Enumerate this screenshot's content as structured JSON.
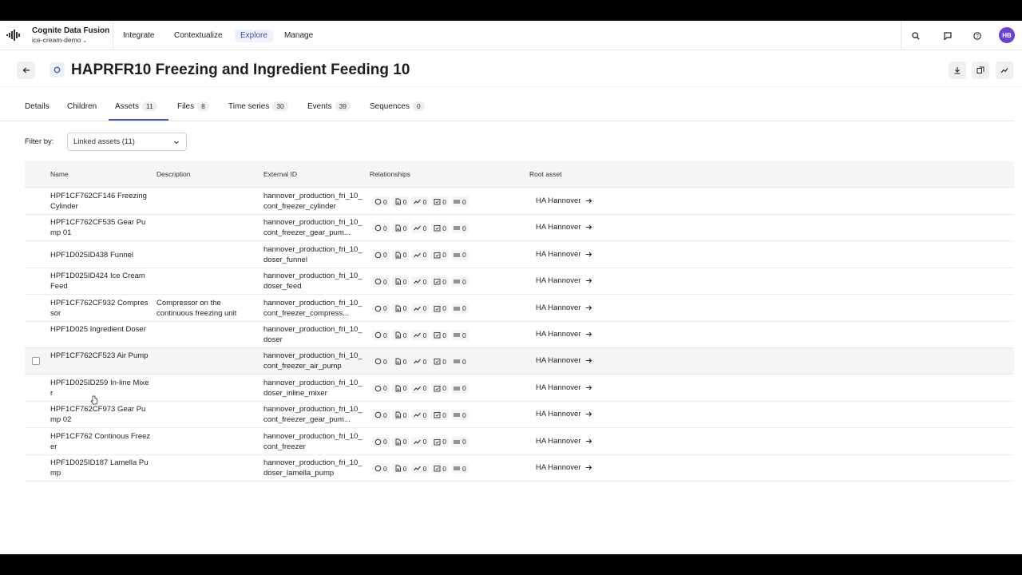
{
  "topnav": {
    "app_name": "Cognite Data Fusion",
    "project": "ice-cream-demo",
    "items": [
      {
        "label": "Integrate",
        "active": false
      },
      {
        "label": "Contextualize",
        "active": false
      },
      {
        "label": "Explore",
        "active": true
      },
      {
        "label": "Manage",
        "active": false
      }
    ],
    "icons": [
      "search-icon",
      "feedback-icon",
      "help-icon"
    ],
    "avatar": "HB"
  },
  "header": {
    "title": "HAPRFR10 Freezing and Ingredient Feeding 10",
    "actions": [
      "download-icon",
      "copy-icon",
      "chart-icon"
    ]
  },
  "tabs": [
    {
      "label": "Details",
      "count": null,
      "active": false
    },
    {
      "label": "Children",
      "count": null,
      "active": false
    },
    {
      "label": "Assets",
      "count": "11",
      "active": true
    },
    {
      "label": "Files",
      "count": "8",
      "active": false
    },
    {
      "label": "Time series",
      "count": "30",
      "active": false
    },
    {
      "label": "Events",
      "count": "39",
      "active": false
    },
    {
      "label": "Sequences",
      "count": "0",
      "active": false
    }
  ],
  "filter": {
    "label": "Filter by:",
    "selected": "Linked assets (11)"
  },
  "table": {
    "columns": [
      "Name",
      "Description",
      "External ID",
      "Relationships",
      "Root asset"
    ],
    "rows": [
      {
        "name": "HPF1CF762CF146 Freezing Cylinder",
        "description": "",
        "external_id": "hannover_production_fri_10_cont_freezer_cylinder",
        "rel": [
          "0",
          "0",
          "0",
          "0",
          "0"
        ],
        "root": "HA Hannover"
      },
      {
        "name": "HPF1CF762CF535 Gear Pump 01",
        "description": "",
        "external_id": "hannover_production_fri_10_cont_freezer_gear_pum...",
        "rel": [
          "0",
          "0",
          "0",
          "0",
          "0"
        ],
        "root": "HA Hannover"
      },
      {
        "name": "HPF1D025ID438 Funnel",
        "description": "",
        "external_id": "hannover_production_fri_10_doser_funnel",
        "rel": [
          "0",
          "0",
          "0",
          "0",
          "0"
        ],
        "root": "HA Hannover"
      },
      {
        "name": "HPF1D025ID424 Ice Cream Feed",
        "description": "",
        "external_id": "hannover_production_fri_10_doser_feed",
        "rel": [
          "0",
          "0",
          "0",
          "0",
          "0"
        ],
        "root": "HA Hannover"
      },
      {
        "name": "HPF1CF762CF932 Compressor",
        "description": "Compressor on the continuous freezing unit",
        "external_id": "hannover_production_fri_10_cont_freezer_compress...",
        "rel": [
          "0",
          "0",
          "0",
          "0",
          "0"
        ],
        "root": "HA Hannover"
      },
      {
        "name": "HPF1D025 Ingredient Doser",
        "description": "",
        "external_id": "hannover_production_fri_10_doser",
        "rel": [
          "0",
          "0",
          "0",
          "0",
          "0"
        ],
        "root": "HA Hannover"
      },
      {
        "name": "HPF1CF762CF523 Air Pump",
        "description": "",
        "external_id": "hannover_production_fri_10_cont_freezer_air_pump",
        "rel": [
          "0",
          "0",
          "0",
          "0",
          "0"
        ],
        "root": "HA Hannover"
      },
      {
        "name": "HPF1D025ID259 In-line Mixer",
        "description": "",
        "external_id": "hannover_production_fri_10_doser_inline_mixer",
        "rel": [
          "0",
          "0",
          "0",
          "0",
          "0"
        ],
        "root": "HA Hannover"
      },
      {
        "name": "HPF1CF762CF973 Gear Pump 02",
        "description": "",
        "external_id": "hannover_production_fri_10_cont_freezer_gear_pum...",
        "rel": [
          "0",
          "0",
          "0",
          "0",
          "0"
        ],
        "root": "HA Hannover"
      },
      {
        "name": "HPF1CF762 Continous Freezer",
        "description": "",
        "external_id": "hannover_production_fri_10_cont_freezer",
        "rel": [
          "0",
          "0",
          "0",
          "0",
          "0"
        ],
        "root": "HA Hannover"
      },
      {
        "name": "HPF1D025ID187 Lamella Pump",
        "description": "",
        "external_id": "hannover_production_fri_10_doser_lamella_pump",
        "rel": [
          "0",
          "0",
          "0",
          "0",
          "0"
        ],
        "root": "HA Hannover"
      }
    ],
    "hover_row": 6
  },
  "colors": {
    "accent": "#4255bb",
    "avatar": "#6d3fd6"
  }
}
